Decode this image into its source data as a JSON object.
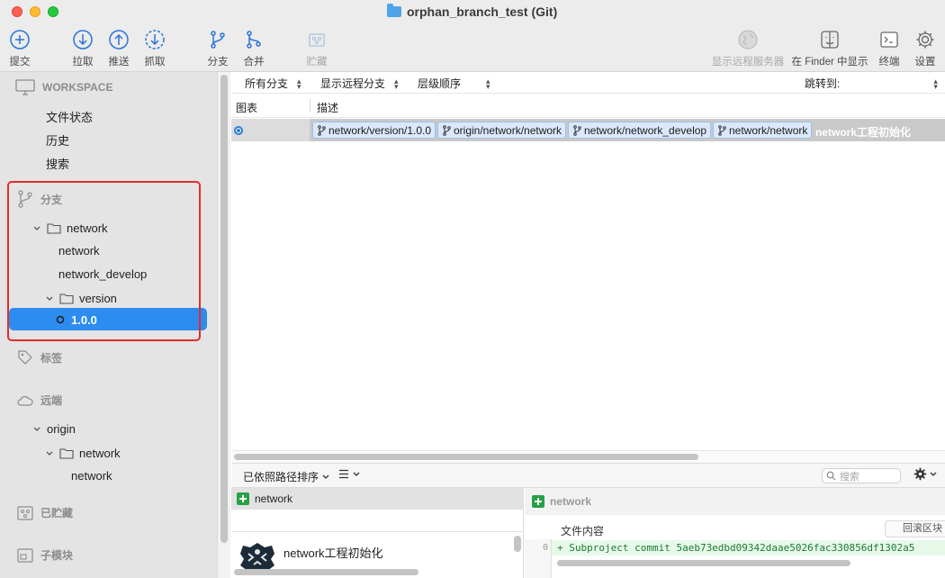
{
  "window": {
    "title": "orphan_branch_test (Git)"
  },
  "toolbar": {
    "commit": "提交",
    "pull": "拉取",
    "push": "推送",
    "fetch": "抓取",
    "branch": "分支",
    "merge": "合并",
    "stash": "贮藏",
    "show_remote": "显示远程服务器",
    "show_in_finder": "在 Finder 中显示",
    "terminal": "终端",
    "settings": "设置"
  },
  "sidebar": {
    "workspace": {
      "heading": "WORKSPACE",
      "items": [
        "文件状态",
        "历史",
        "搜索"
      ]
    },
    "branches": {
      "heading": "分支",
      "folder": "network",
      "items": [
        "network",
        "network_develop"
      ],
      "subfolder": "version",
      "selected": "1.0.0"
    },
    "tags": {
      "heading": "标签"
    },
    "remotes": {
      "heading": "远端",
      "remote": "origin",
      "folder": "network",
      "items": [
        "network"
      ]
    },
    "stashes": {
      "heading": "已贮藏"
    },
    "submodules": {
      "heading": "子模块"
    }
  },
  "filters": {
    "all_branches": "所有分支",
    "show_remote_branches": "显示远程分支",
    "order": "层级顺序",
    "jump_to": "跳转到:"
  },
  "columns": {
    "graph": "图表",
    "description": "描述"
  },
  "commit": {
    "refs": [
      "network/version/1.0.0",
      "origin/network/network",
      "network/network_develop",
      "network/network"
    ],
    "message": "network工程初始化"
  },
  "bottom": {
    "sort_label": "已依照路径排序",
    "search_placeholder": "搜索",
    "file_name": "network",
    "commit_summary": "network工程初始化",
    "diff_file": "network",
    "hunk_title": "文件内容",
    "revert_hunk": "回滚区块",
    "diff_line_number": "0",
    "diff_line": "+ Subproject commit 5aeb73edbd09342daae5026fac330856df1302a5"
  },
  "colors": {
    "accent": "#2d8cf0",
    "highlight_box": "#e52b2b",
    "added": "#27a046"
  }
}
